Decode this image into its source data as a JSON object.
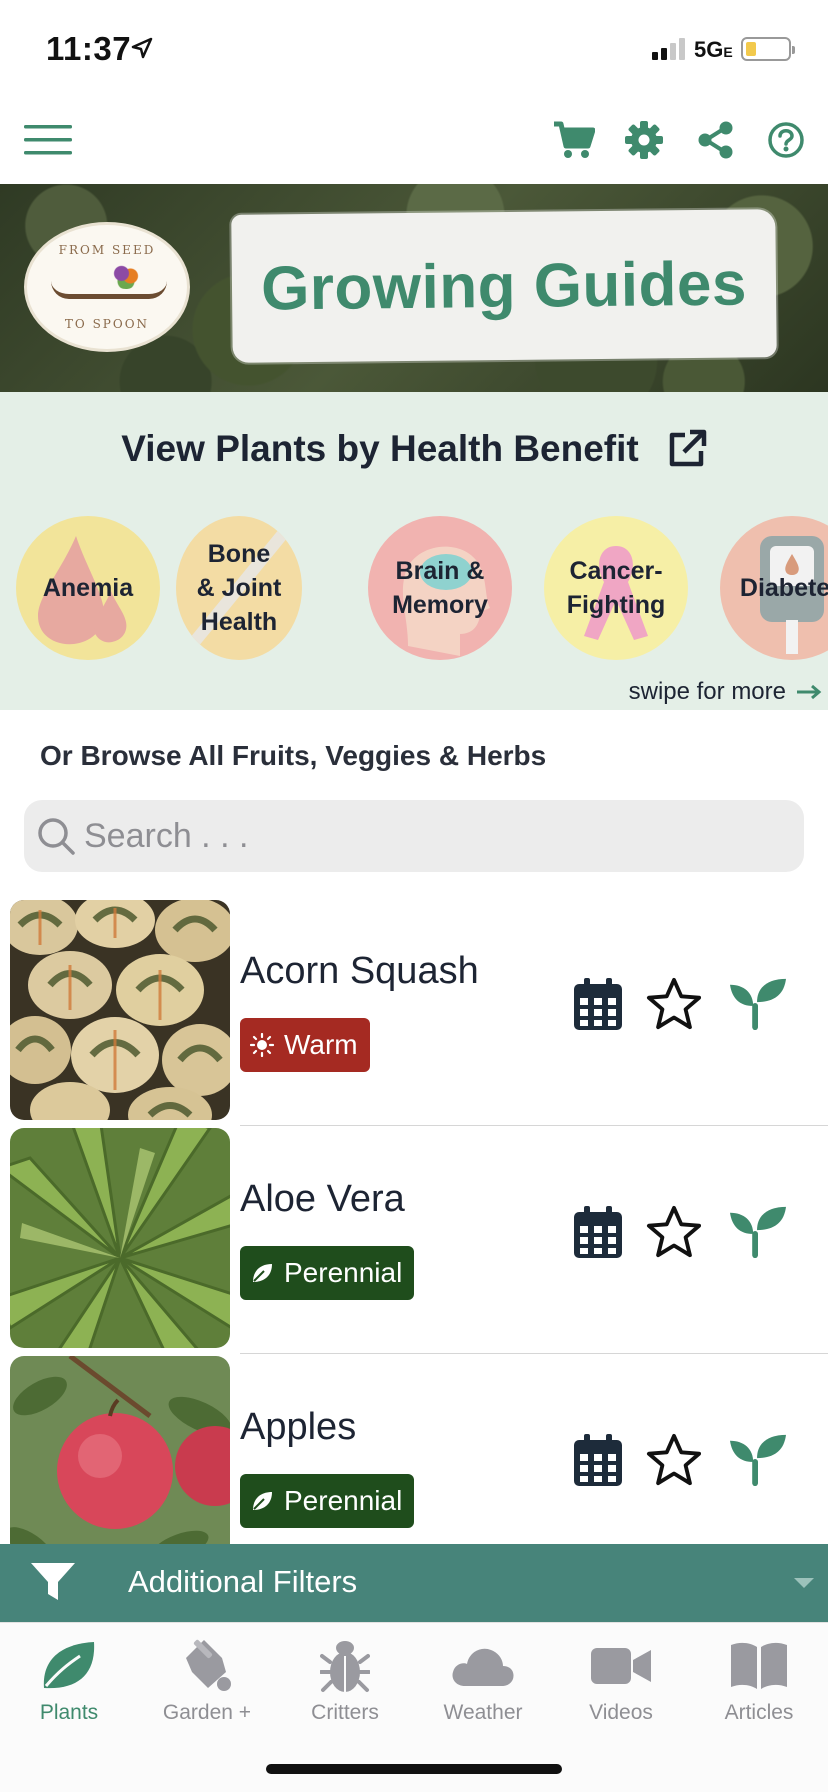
{
  "status_bar": {
    "time": "11:37",
    "network": "5G",
    "network_suffix": "E"
  },
  "toolbar": {
    "icons": [
      "menu-icon",
      "cart-icon",
      "gear-icon",
      "share-icon",
      "help-icon"
    ],
    "accent_color": "#3f8a6d"
  },
  "hero": {
    "logo_top": "FROM SEED",
    "logo_bottom": "TO SPOON",
    "title": "Growing Guides"
  },
  "health": {
    "title": "View Plants by Health Benefit",
    "benefits": [
      {
        "line1": "Anemia",
        "line2": "",
        "line3": "",
        "color": "#f2e49a"
      },
      {
        "line1": "Bone",
        "line2": "& Joint",
        "line3": "Health",
        "color": "#f3dca4"
      },
      {
        "line1": "Brain &",
        "line2": "Memory",
        "line3": "",
        "color": "#f1b3b0"
      },
      {
        "line1": "Cancer-",
        "line2": "Fighting",
        "line3": "",
        "color": "#f6efa6"
      },
      {
        "line1": "Diabetes",
        "line2": "",
        "line3": "",
        "color": "#efbfae"
      }
    ],
    "swipe_text": "swipe for more"
  },
  "browse": {
    "title": "Or Browse All Fruits, Veggies & Herbs",
    "search_placeholder": "Search . . ."
  },
  "plants": [
    {
      "name": "Acorn Squash",
      "badge": "Warm",
      "badge_type": "warm"
    },
    {
      "name": "Aloe Vera",
      "badge": "Perennial",
      "badge_type": "perennial"
    },
    {
      "name": "Apples",
      "badge": "Perennial",
      "badge_type": "perennial"
    }
  ],
  "filters": {
    "label": "Additional Filters"
  },
  "tabs": [
    {
      "label": "Plants",
      "icon": "leaf-icon",
      "active": true
    },
    {
      "label": "Garden +",
      "icon": "seed-bag-icon",
      "active": false
    },
    {
      "label": "Critters",
      "icon": "bug-icon",
      "active": false
    },
    {
      "label": "Weather",
      "icon": "cloud-icon",
      "active": false
    },
    {
      "label": "Videos",
      "icon": "video-camera-icon",
      "active": false
    },
    {
      "label": "Articles",
      "icon": "book-icon",
      "active": false
    }
  ]
}
